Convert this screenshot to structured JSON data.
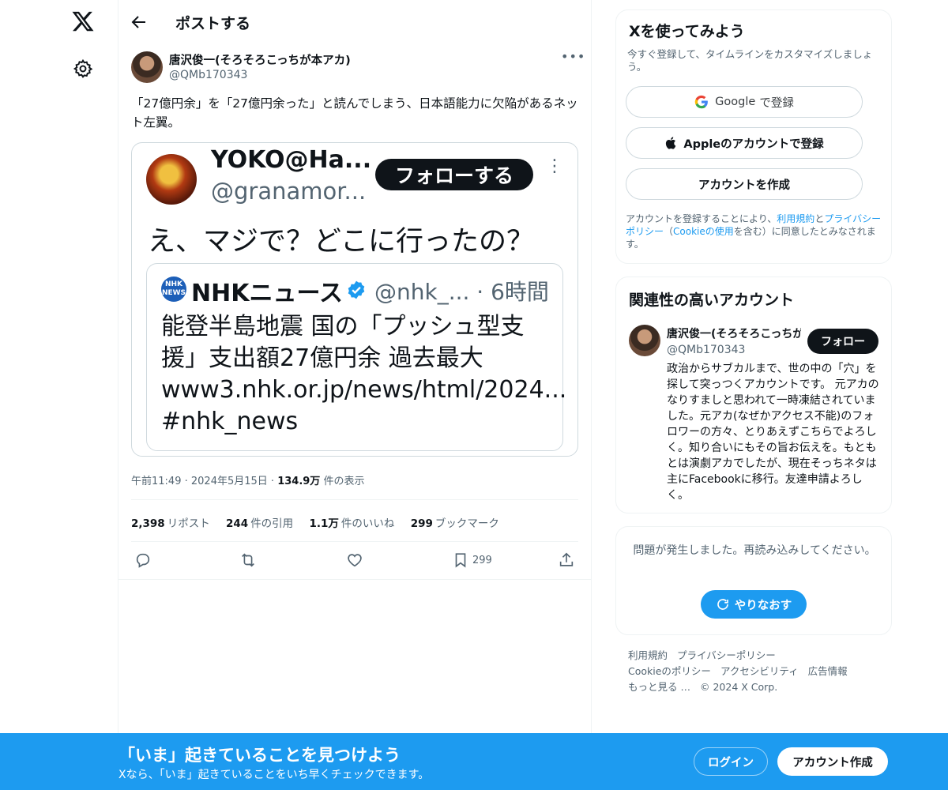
{
  "header": {
    "back_label": "←",
    "title": "ポストする"
  },
  "post": {
    "author_name": "唐沢俊一(そろそろこっちが本アカ)",
    "author_handle": "@QMb170343",
    "more_label": "•••",
    "text": "「27億円余」を「27億円余った」と読んでしまう、日本語能力に欠陥があるネット左翼。",
    "time": "午前11:49",
    "date": "2024年5月15日",
    "views_value": "134.9万",
    "views_label": "件の表示",
    "stats": {
      "reposts_value": "2,398",
      "reposts_label": "リポスト",
      "quotes_value": "244",
      "quotes_label": "件の引用",
      "likes_value": "1.1万",
      "likes_label": "件のいいね",
      "bookmarks_value": "299",
      "bookmarks_label": "ブックマーク"
    },
    "actions": {
      "bookmark_count": "299"
    }
  },
  "quoted_image": {
    "name": "YOKO@Ha...",
    "handle": "@granamor...",
    "follow_label": "フォローする",
    "more_label": "⋮",
    "text": "え、マジで？どこに行ったの？",
    "inner": {
      "logo_text": "NHK NEWS",
      "name": "NHKニュース",
      "meta": "@nhk_... · 6時間",
      "body": "能登半島地震 国の「プッシュ型支援」支出額27億円余 過去最大 www3.nhk.or.jp/news/html/2024... #nhk_news"
    }
  },
  "signup": {
    "title": "Xを使ってみよう",
    "subtitle": "今すぐ登録して、タイムラインをカスタマイズしましょう。",
    "google_brand": "Google",
    "google_label": "で登録",
    "apple_label": "Appleのアカウントで登録",
    "create_label": "アカウントを作成",
    "legal_1": "アカウントを登録することにより、",
    "legal_terms": "利用規約",
    "legal_2": "と",
    "legal_privacy": "プライバシーポリシー",
    "legal_3": "（",
    "legal_cookie": "Cookieの使用",
    "legal_4": "を含む）に同意したとみなされます。"
  },
  "related": {
    "title": "関連性の高いアカウント",
    "name": "唐沢俊一(そろそろこっちが本アカ)",
    "handle": "@QMb170343",
    "follow_label": "フォロー",
    "bio": "政治からサブカルまで、世の中の「穴」を探して突っつくアカウントです。 元アカのなりすましと思われて一時凍結されていました。元アカ(なぜかアクセス不能)のフォロワーの方々、とりあえずこちらでよろしく。知り合いにもその旨お伝えを。もともとは演劇アカでしたが、現在そっちネタは主にFacebookに移行。友達申請よろしく。"
  },
  "error_card": {
    "message": "問題が発生しました。再読み込みしてください。",
    "retry_label": "やりなおす"
  },
  "footer": {
    "links": [
      "利用規約",
      "プライバシーポリシー",
      "Cookieのポリシー",
      "アクセシビリティ",
      "広告情報",
      "もっと見る …",
      "© 2024 X Corp."
    ]
  },
  "banner": {
    "title": "「いま」起きていることを見つけよう",
    "subtitle": "Xなら、「いま」起きていることをいち早くチェックできます。",
    "login_label": "ログイン",
    "create_label": "アカウント作成"
  },
  "colors": {
    "accent": "#1d9bf0",
    "text": "#0f1419",
    "secondary": "#536471",
    "border": "#cfd9de"
  }
}
